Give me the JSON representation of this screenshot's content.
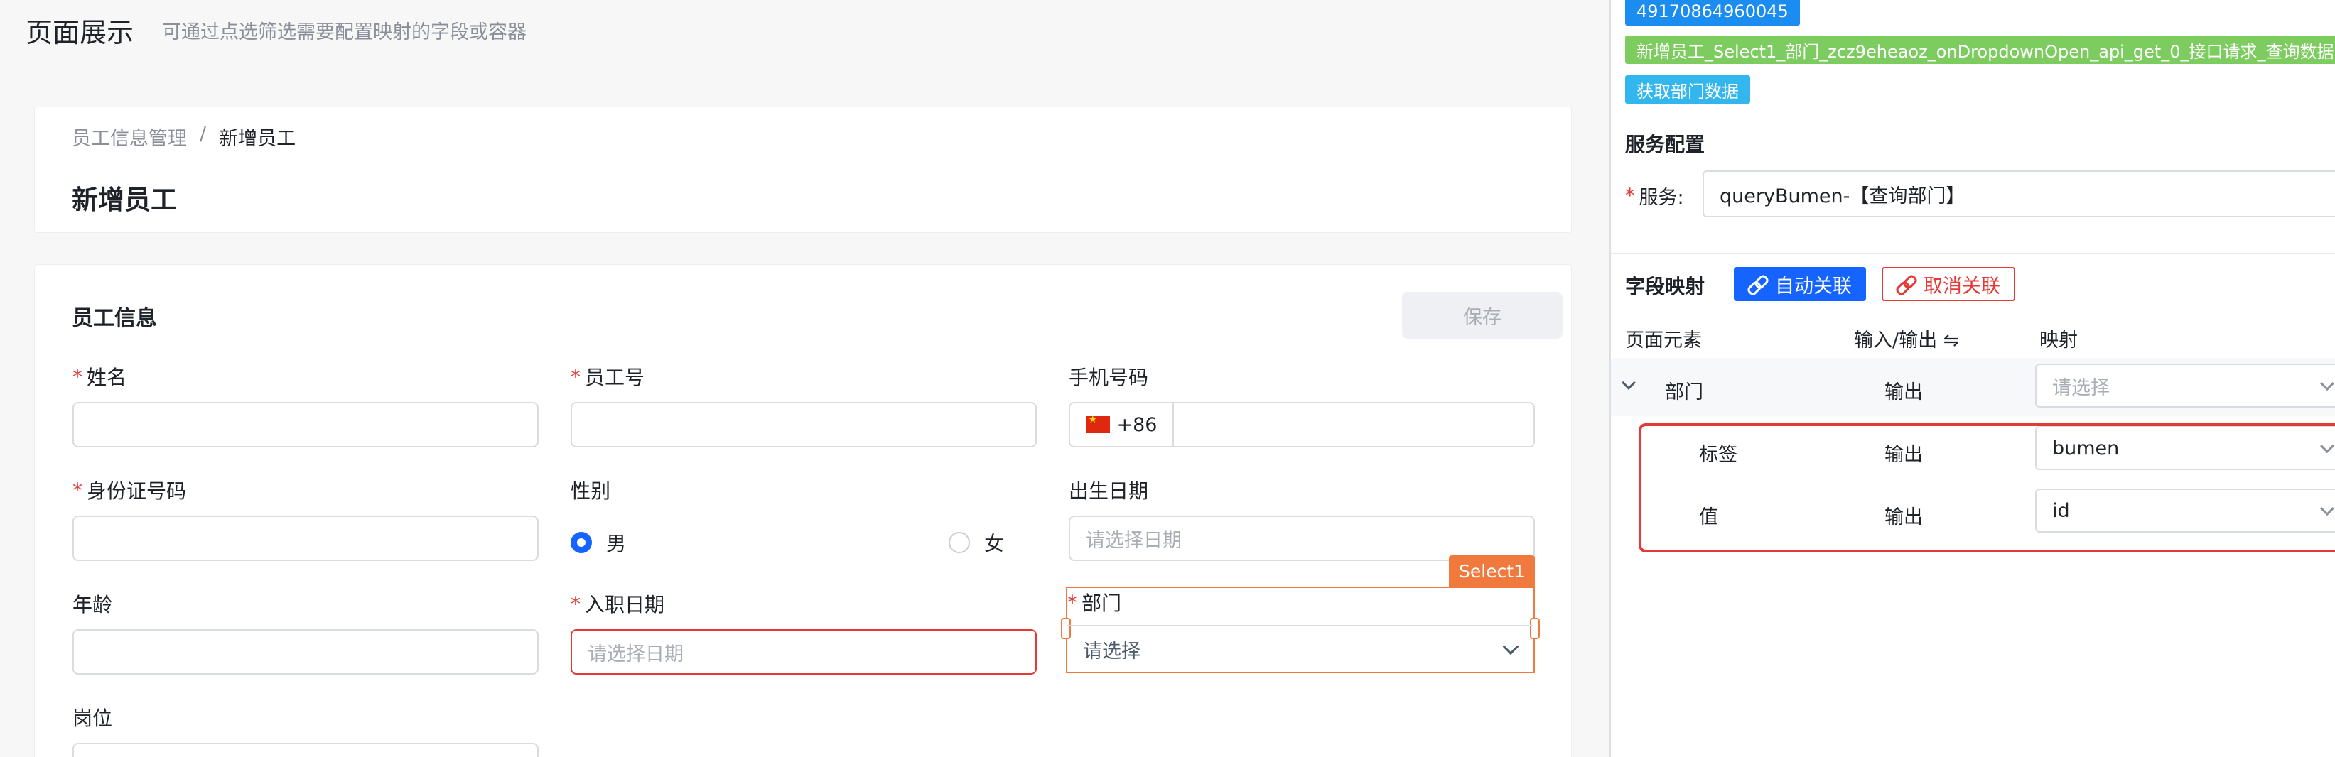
{
  "page": {
    "title": "页面展示",
    "subtitle": "可通过点选筛选需要配置映射的字段或容器"
  },
  "breadcrumb": {
    "parent": "员工信息管理",
    "separator": "/",
    "current": "新增员工"
  },
  "heading": "新增员工",
  "form": {
    "section_title": "员工信息",
    "save_label": "保存",
    "fields": {
      "name": {
        "label": "姓名",
        "required": "*"
      },
      "employee_no": {
        "label": "员工号",
        "required": "*"
      },
      "phone": {
        "label": "手机号码",
        "prefix": "+86"
      },
      "id_card": {
        "label": "身份证号码",
        "required": "*"
      },
      "gender": {
        "label": "性别",
        "options": [
          "男",
          "女"
        ],
        "selected": "男"
      },
      "birth_date": {
        "label": "出生日期",
        "placeholder": "请选择日期"
      },
      "age": {
        "label": "年龄"
      },
      "join_date": {
        "label": "入职日期",
        "required": "*",
        "placeholder": "请选择日期"
      },
      "department": {
        "label": "部门",
        "required": "*",
        "placeholder": "请选择",
        "component_tag": "Select1"
      },
      "position": {
        "label": "岗位"
      }
    }
  },
  "panel": {
    "chips": {
      "id": "49170864960045",
      "event": "新增员工_Select1_部门_zcz9eheaoz_onDropdownOpen_api_get_0_接口请求_查询数据",
      "action": "获取部门数据"
    },
    "service_config": {
      "title": "服务配置",
      "required": "*",
      "label": "服务:",
      "value": "queryBumen-【查询部门】"
    },
    "field_mapping": {
      "title": "字段映射",
      "auto_link": "自动关联",
      "cancel_link": "取消关联",
      "columns": [
        "页面元素",
        "输入/输出 ⇋",
        "映射"
      ],
      "rows": [
        {
          "element": "部门",
          "io": "输出",
          "mapping": "请选择"
        },
        {
          "element": "标签",
          "io": "输出",
          "mapping": "bumen"
        },
        {
          "element": "值",
          "io": "输出",
          "mapping": "id"
        }
      ]
    }
  },
  "colors": {
    "primary": "#1664ff",
    "error": "#e53935",
    "selection": "#f07a3e"
  }
}
